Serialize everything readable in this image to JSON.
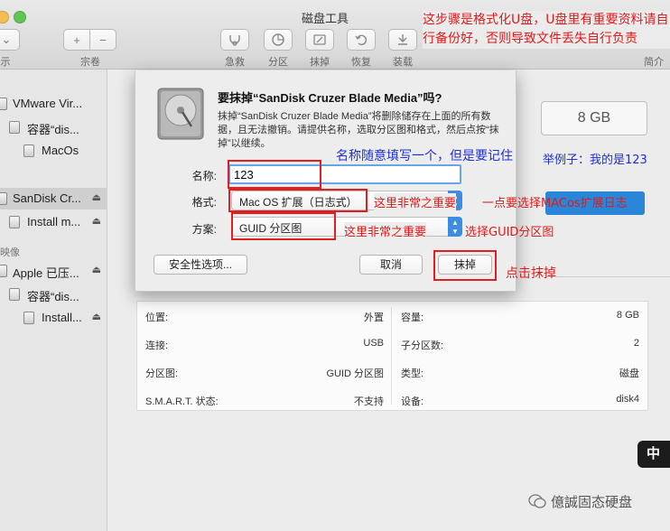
{
  "window": {
    "title": "磁盘工具"
  },
  "toolbar": {
    "left_label_1": "示",
    "volume_label": "宗卷",
    "add": "+",
    "remove": "−",
    "buttons": [
      {
        "label": "急救",
        "icon": "stethoscope-icon"
      },
      {
        "label": "分区",
        "icon": "pie-icon"
      },
      {
        "label": "抹掉",
        "icon": "erase-icon"
      },
      {
        "label": "恢复",
        "icon": "restore-icon"
      },
      {
        "label": "装载",
        "icon": "mount-icon"
      }
    ],
    "info_label": "简介"
  },
  "sidebar": {
    "items": [
      {
        "label": "VMware Vir...",
        "icon": "disk-icon"
      },
      {
        "label": "容器“dis...",
        "icon": "container-icon"
      },
      {
        "label": "MacOs",
        "icon": "volume-icon"
      },
      {
        "label": "SanDisk Cr...",
        "icon": "usb-disk-icon",
        "eject": "⏏"
      },
      {
        "label": "Install m...",
        "icon": "volume-icon",
        "eject": "⏏"
      },
      {
        "label": "Apple 已压...",
        "icon": "disk-image-icon",
        "eject": "⏏"
      },
      {
        "label": "容器“dis...",
        "icon": "container-icon"
      },
      {
        "label": "Install...",
        "icon": "volume-icon",
        "eject": "⏏"
      }
    ],
    "section_images": "映像"
  },
  "main": {
    "size": "8 GB"
  },
  "info": {
    "left": [
      {
        "k": "位置:",
        "v": "外置"
      },
      {
        "k": "连接:",
        "v": "USB"
      },
      {
        "k": "分区图:",
        "v": "GUID 分区图"
      },
      {
        "k": "S.M.A.R.T. 状态:",
        "v": "不支持"
      }
    ],
    "right": [
      {
        "k": "容量:",
        "v": "8 GB"
      },
      {
        "k": "子分区数:",
        "v": "2"
      },
      {
        "k": "类型:",
        "v": "磁盘"
      },
      {
        "k": "设备:",
        "v": "disk4"
      }
    ]
  },
  "dialog": {
    "title": "要抹掉“SanDisk Cruzer Blade Media”吗?",
    "description": "抹掉“SanDisk Cruzer Blade Media”将删除储存在上面的所有数据，且无法撤销。请提供名称，选取分区图和格式，然后点按“抹掉”以继续。",
    "name_label": "名称:",
    "name_value": "123",
    "format_label": "格式:",
    "format_value": "Mac OS 扩展（日志式）",
    "scheme_label": "方案:",
    "scheme_value": "GUID 分区图",
    "security_button": "安全性选项...",
    "cancel_button": "取消",
    "erase_button": "抹掉"
  },
  "annotations": {
    "top_note": "这步骤是格式化U盘，U盘里有重要资料请自行备份好，否则导致文件丢失自行负责",
    "name_tip": "名称随意填写一个，但是要记住",
    "example": "举例子：我的是123",
    "format_tip_1": "这里非常之重要",
    "format_tip_2": "一点要选择MACos扩展日志",
    "scheme_tip_1": "这里非常之重要",
    "scheme_tip_2": "选择GUID分区图",
    "erase_tip": "点击抹掉"
  },
  "watermark": {
    "badge": "中",
    "text": "億誠固态硬盘"
  },
  "colors": {
    "accent": "#3b8de2",
    "annotation_red": "#e01a1a",
    "annotation_blue": "#1d2fd6"
  }
}
